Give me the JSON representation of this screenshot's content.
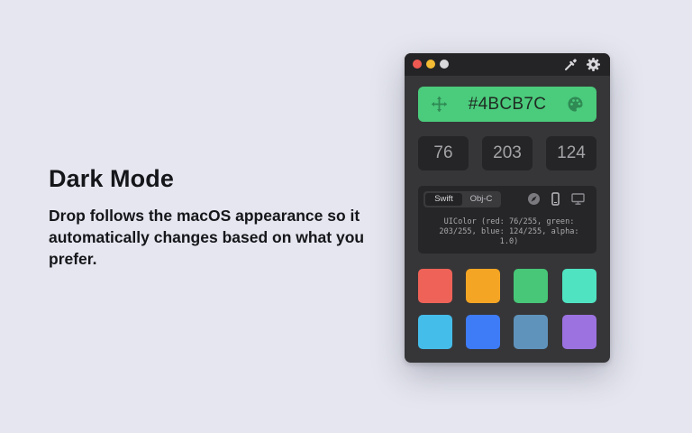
{
  "promo": {
    "title": "Dark Mode",
    "body": "Drop follows the macOS appearance so it automatically changes based on what you prefer."
  },
  "window": {
    "titlebar": {
      "icons": [
        "eyedropper-icon",
        "gear-icon"
      ]
    },
    "hex": {
      "value": "#4BCB7C",
      "color": "#4bcb7c",
      "icons": [
        "move-arrows-icon",
        "palette-icon"
      ]
    },
    "rgb": {
      "red": "76",
      "green": "203",
      "blue": "124"
    },
    "code": {
      "tabs": [
        "Swift",
        "Obj-C"
      ],
      "selected_tab": "Swift",
      "platform_icons": [
        "safari-compass-icon",
        "iphone-icon",
        "desktop-icon"
      ],
      "text": "UIColor (red: 76/255, green: 203/255, blue: 124/255, alpha: 1.0)"
    },
    "swatches": [
      "#ef6258",
      "#f5a524",
      "#47c777",
      "#50e3c2",
      "#45bdea",
      "#3e7bf7",
      "#5f93bc",
      "#9b72e0"
    ]
  }
}
